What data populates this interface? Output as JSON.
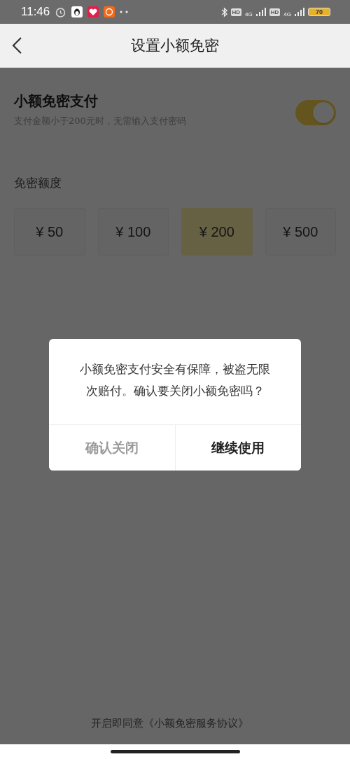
{
  "status_bar": {
    "time": "11:46",
    "hd_1": "HD",
    "network_1": "4G",
    "hd_2": "HD",
    "network_2": "4G",
    "battery": "70"
  },
  "header": {
    "title": "设置小额免密"
  },
  "setting": {
    "title": "小额免密支付",
    "description": "支付金额小于200元时，无需输入支付密码",
    "on": true
  },
  "limit": {
    "label": "免密额度",
    "options": [
      {
        "label": "¥ 50",
        "selected": false
      },
      {
        "label": "¥ 100",
        "selected": false
      },
      {
        "label": "¥ 200",
        "selected": true
      },
      {
        "label": "¥ 500",
        "selected": false
      }
    ]
  },
  "footer": {
    "agreement": "开启即同意《小额免密服务协议》"
  },
  "dialog": {
    "message": "小额免密支付安全有保障，被盗无限次赔付。确认要关闭小额免密吗？",
    "buttons": [
      {
        "label": "确认关闭",
        "kind": "secondary"
      },
      {
        "label": "继续使用",
        "kind": "primary"
      }
    ]
  }
}
